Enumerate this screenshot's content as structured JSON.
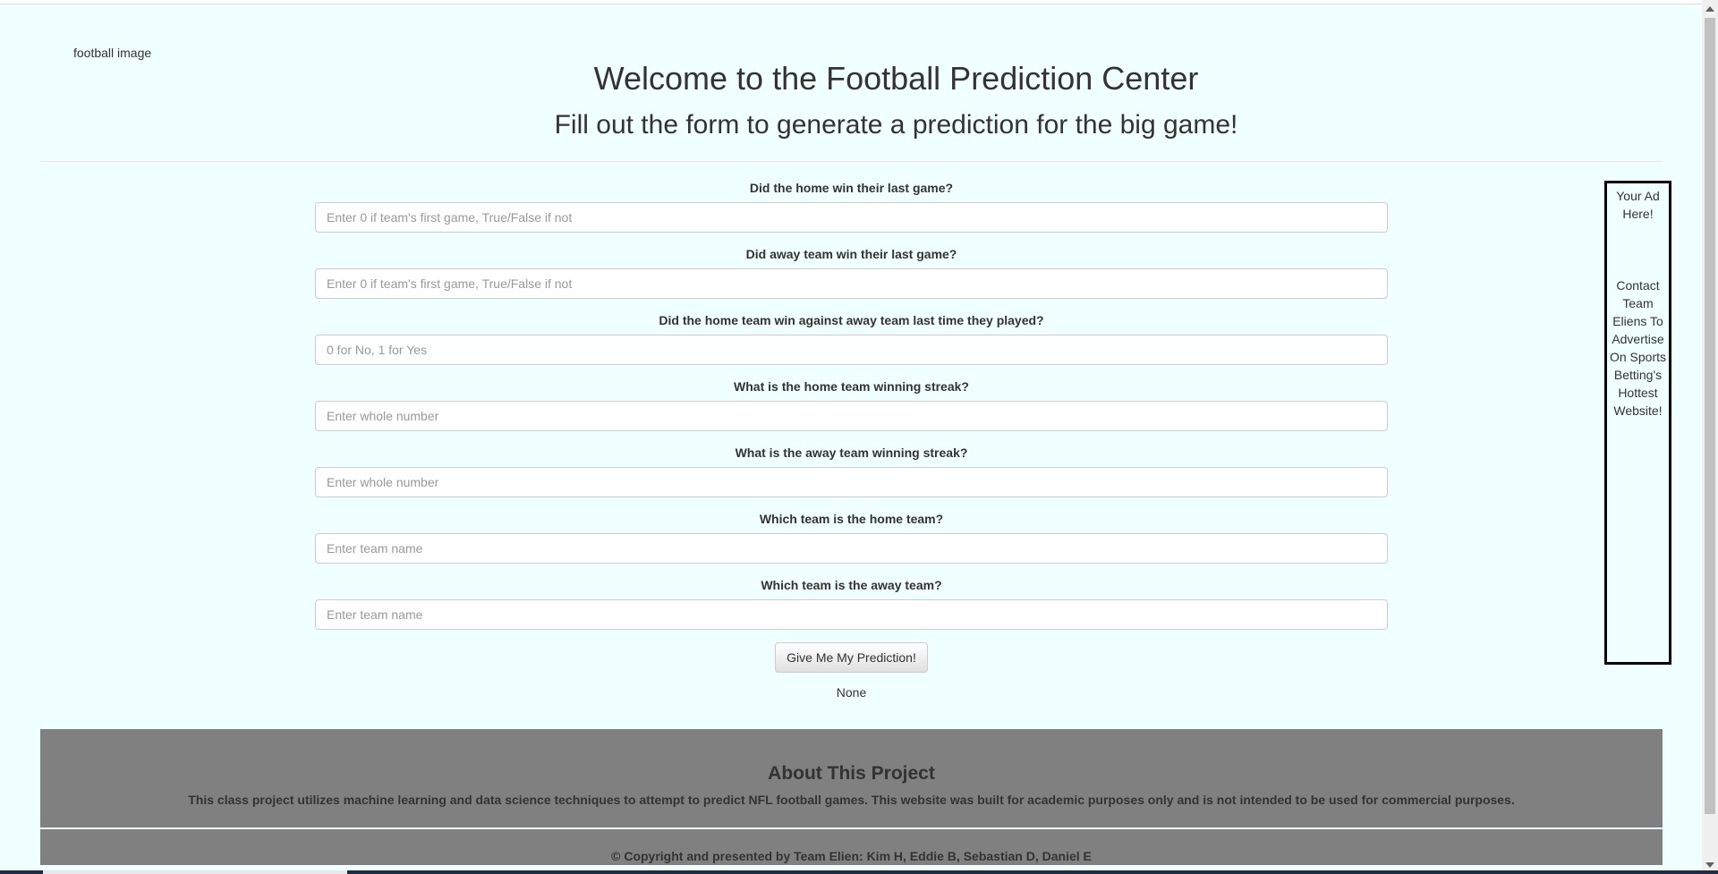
{
  "logo": {
    "alt_text": "football image"
  },
  "header": {
    "title": "Welcome to the Football Prediction Center",
    "subtitle": "Fill out the form to generate a prediction for the big game!"
  },
  "form": {
    "fields": [
      {
        "label": "Did the home win their last game?",
        "placeholder": "Enter 0 if team's first game, True/False if not"
      },
      {
        "label": "Did away team win their last game?",
        "placeholder": "Enter 0 if team's first game, True/False if not"
      },
      {
        "label": "Did the home team win against away team last time they played?",
        "placeholder": "0 for No, 1 for Yes"
      },
      {
        "label": "What is the home team winning streak?",
        "placeholder": "Enter whole number"
      },
      {
        "label": "What is the away team winning streak?",
        "placeholder": "Enter whole number"
      },
      {
        "label": "Which team is the home team?",
        "placeholder": "Enter team name"
      },
      {
        "label": "Which team is the away team?",
        "placeholder": "Enter team name"
      }
    ],
    "submit_label": "Give Me My Prediction!",
    "result": "None"
  },
  "ad": {
    "headline": "Your Ad Here!",
    "body": "Contact Team Eliens To Advertise On Sports Betting's Hottest Website!"
  },
  "about": {
    "title": "About This Project",
    "text": "This class project utilizes machine learning and data science techniques to attempt to predict NFL football games. This website was built for academic purposes only and is not intended to be used for commercial purposes."
  },
  "footer": {
    "copyright": "© Copyright and presented by Team Elien: Kim H, Eddie B, Sebastian D, Daniel E"
  }
}
